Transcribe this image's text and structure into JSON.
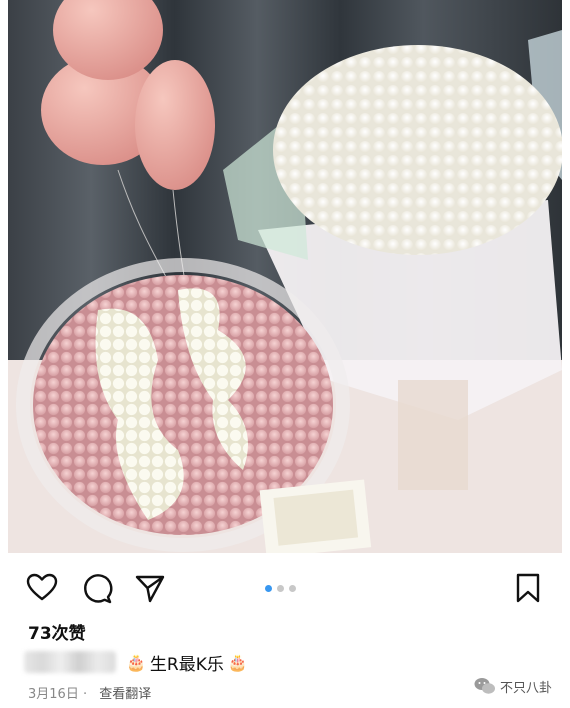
{
  "post": {
    "likes_text": "73次赞",
    "caption_text": "生R最K乐",
    "cake_emoji": "🎂",
    "date": "3月16日",
    "translate_label": "查看翻译"
  },
  "actions": {
    "like_icon": "heart-icon",
    "comment_icon": "comment-icon",
    "share_icon": "share-icon",
    "save_icon": "bookmark-icon"
  },
  "carousel": {
    "count": 3,
    "active": 1
  },
  "watermark": {
    "text": "不只八卦"
  },
  "colors": {
    "active_dot": "#3897f0",
    "inactive_dot": "#c8c8c8"
  }
}
